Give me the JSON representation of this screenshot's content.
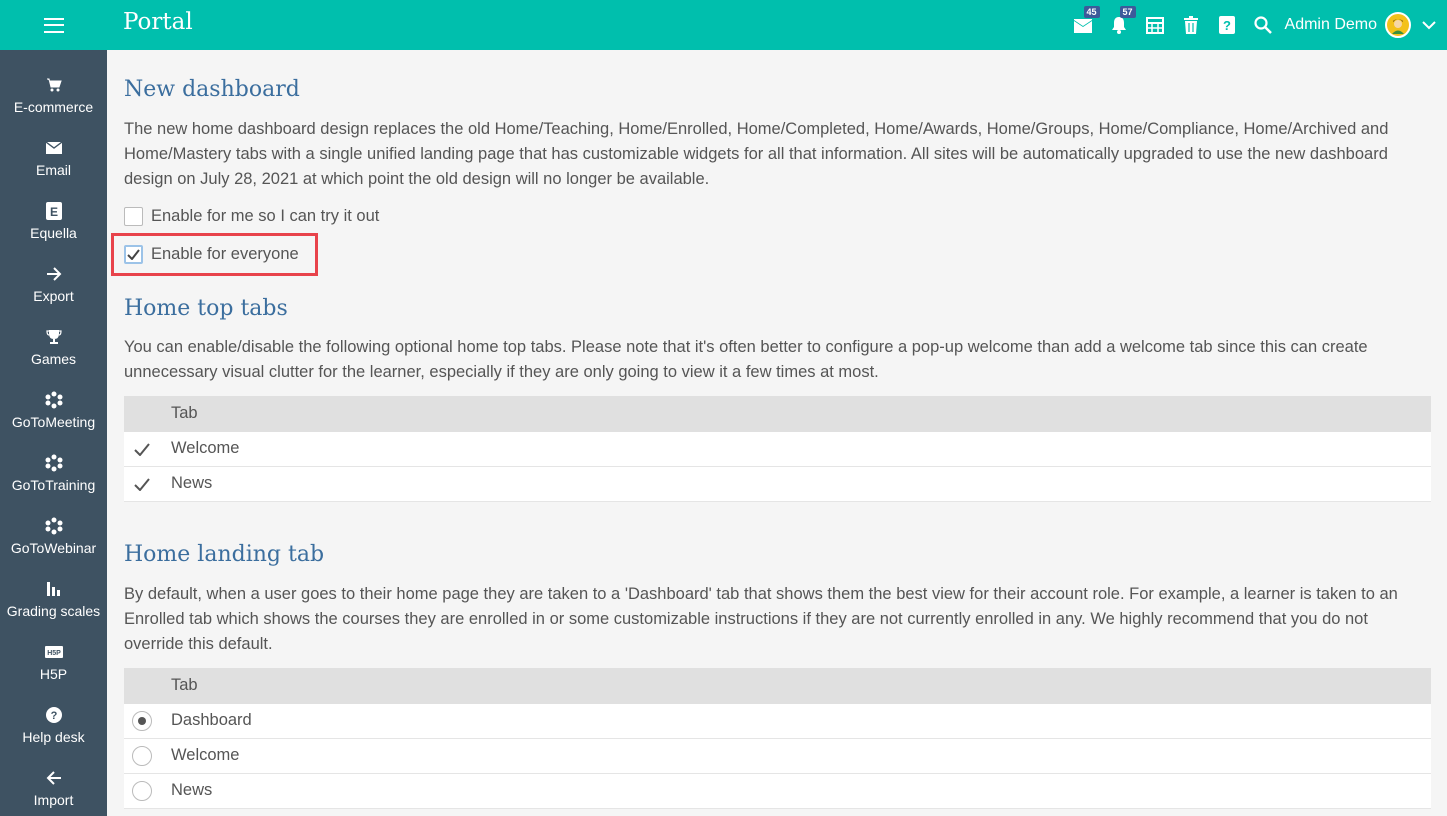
{
  "topbar": {
    "title": "Portal",
    "mail_badge": "45",
    "notifications_badge": "57",
    "user_name": "Admin Demo"
  },
  "sidebar": {
    "items": [
      {
        "label": "E-commerce",
        "icon": "cart-icon"
      },
      {
        "label": "Email",
        "icon": "envelope-icon"
      },
      {
        "label": "Equella",
        "icon": "equella-icon"
      },
      {
        "label": "Export",
        "icon": "arrow-right-icon"
      },
      {
        "label": "Games",
        "icon": "trophy-icon"
      },
      {
        "label": "GoToMeeting",
        "icon": "gotomeeting-icon"
      },
      {
        "label": "GoToTraining",
        "icon": "gototraining-icon"
      },
      {
        "label": "GoToWebinar",
        "icon": "gotowebinar-icon"
      },
      {
        "label": "Grading scales",
        "icon": "bar-chart-icon"
      },
      {
        "label": "H5P",
        "icon": "h5p-icon"
      },
      {
        "label": "Help desk",
        "icon": "question-circle-icon"
      },
      {
        "label": "Import",
        "icon": "arrow-left-icon"
      }
    ]
  },
  "new_dashboard": {
    "heading": "New dashboard",
    "description": "The new home dashboard design replaces the old Home/Teaching, Home/Enrolled, Home/Completed, Home/Awards, Home/Groups, Home/Compliance, Home/Archived and Home/Mastery tabs with a single unified landing page that has customizable widgets for all that information. All sites will be automatically upgraded to use the new dashboard design on July 28, 2021 at which point the old design will no longer be available.",
    "option_me": {
      "label": "Enable for me so I can try it out",
      "checked": false
    },
    "option_everyone": {
      "label": "Enable for everyone",
      "checked": true
    }
  },
  "home_top_tabs": {
    "heading": "Home top tabs",
    "description": "You can enable/disable the following optional home top tabs. Please note that it's often better to configure a pop-up welcome than add a welcome tab since this can create unnecessary visual clutter for the learner, especially if they are only going to view it a few times at most.",
    "column_header": "Tab",
    "rows": [
      {
        "label": "Welcome",
        "checked": true
      },
      {
        "label": "News",
        "checked": true
      }
    ]
  },
  "home_landing_tab": {
    "heading": "Home landing tab",
    "description": "By default, when a user goes to their home page they are taken to a 'Dashboard' tab that shows them the best view for their account role. For example, a learner is taken to an Enrolled tab which shows the courses they are enrolled in or some customizable instructions if they are not currently enrolled in any. We highly recommend that you do not override this default.",
    "column_header": "Tab",
    "rows": [
      {
        "label": "Dashboard",
        "selected": true
      },
      {
        "label": "Welcome",
        "selected": false
      },
      {
        "label": "News",
        "selected": false
      }
    ]
  },
  "colors": {
    "topbar": "#00bfad",
    "sidebar": "#3e5262",
    "heading": "#3b6e9e",
    "highlight": "#e8434b"
  }
}
